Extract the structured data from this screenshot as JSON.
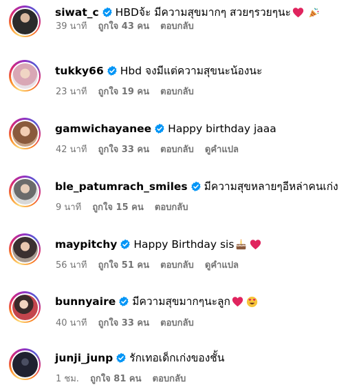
{
  "comments": [
    {
      "username": "siwat_c",
      "text": "HBDจ้ะ มีความสุขมากๆ สวยๆรวยๆนะ",
      "time": "39 นาที",
      "likes": "ถูกใจ 43 คน",
      "reply": "ตอบกลับ",
      "translate": "",
      "emoji": [
        "red-heart",
        "party-popper"
      ],
      "avatar_color": "#3a3a3a"
    },
    {
      "username": "tukky66",
      "text": "Hbd จงมีแต่ความสุขนะน้องนะ",
      "time": "23 นาที",
      "likes": "ถูกใจ 19 คน",
      "reply": "ตอบกลับ",
      "translate": "",
      "emoji": [],
      "avatar_color": "#d9a7b5"
    },
    {
      "username": "gamwichayanee",
      "text": "Happy birthday jaaa",
      "time": "42 นาที",
      "likes": "ถูกใจ 33 คน",
      "reply": "ตอบกลับ",
      "translate": "ดูคำแปล",
      "emoji": [],
      "avatar_color": "#b98a6a"
    },
    {
      "username": "ble_patumrach_smiles",
      "text": "มีความสุขหลายๆอีหล่าคนเก่ง",
      "time": "9 นาที",
      "likes": "ถูกใจ 15 คน",
      "reply": "ตอบกลับ",
      "translate": "",
      "emoji": [],
      "avatar_color": "#8c8c8c"
    },
    {
      "username": "maypitchy",
      "text": "Happy Birthday sis",
      "time": "56 นาที",
      "likes": "ถูกใจ 51 คน",
      "reply": "ตอบกลับ",
      "translate": "ดูคำแปล",
      "emoji": [
        "birthday-cake",
        "red-heart"
      ],
      "avatar_color": "#7a6a60"
    },
    {
      "username": "bunnyaire",
      "text": "มีความสุขมากๆนะลูก",
      "time": "40 นาที",
      "likes": "ถูกใจ 33 คน",
      "reply": "ตอบกลับ",
      "translate": "",
      "emoji": [
        "red-heart",
        "heart-eyes-face"
      ],
      "avatar_color": "#c4454d"
    },
    {
      "username": "junji_junp",
      "text": "รักเทอเด็กเก่งของชั้น",
      "time": "1 ชม.",
      "likes": "ถูกใจ 81 คน",
      "reply": "ตอบกลับ",
      "translate": "",
      "emoji": [],
      "avatar_color": "#1f2130"
    }
  ],
  "colors": {
    "verified": "#0095f6",
    "meta_text": "#737373",
    "heart": "#e0245e"
  }
}
